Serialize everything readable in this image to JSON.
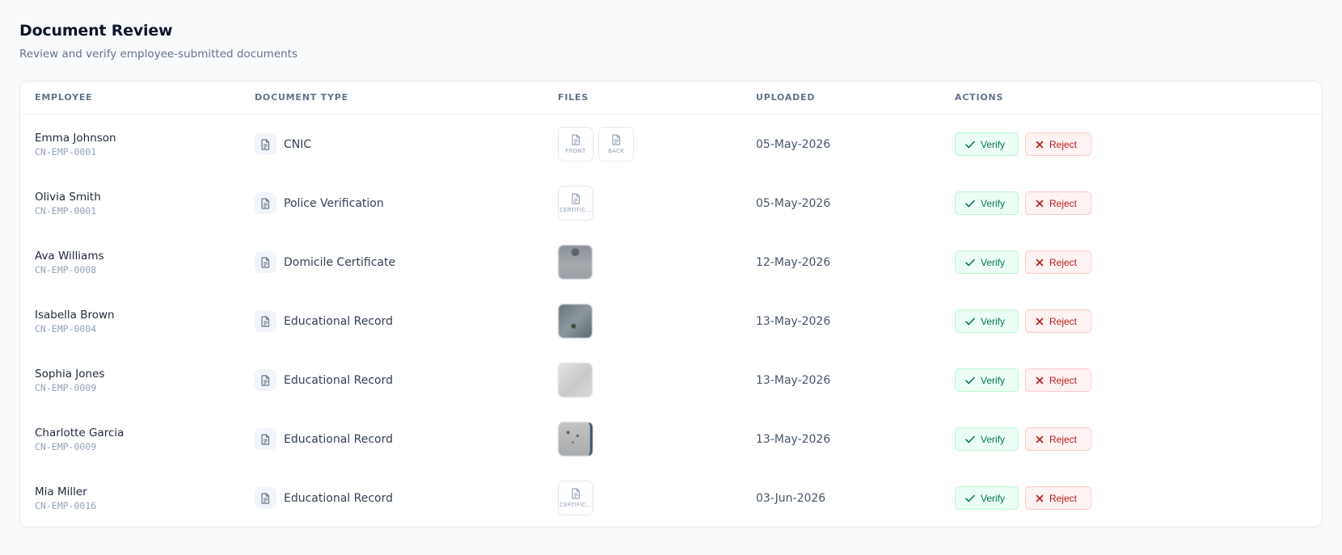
{
  "header": {
    "title": "Document Review",
    "subtitle": "Review and verify employee-submitted documents"
  },
  "table": {
    "columns": [
      "EMPLOYEE",
      "DOCUMENT TYPE",
      "FILES",
      "UPLOADED",
      "ACTIONS"
    ],
    "verify_label": "Verify",
    "reject_label": "Reject",
    "rows": [
      {
        "name": "Emma Johnson",
        "id": "CN-EMP-0001",
        "doc_type": "CNIC",
        "files": [
          {
            "kind": "doc",
            "caption": "FRONT"
          },
          {
            "kind": "doc",
            "caption": "BACK"
          }
        ],
        "uploaded": "05-May-2026"
      },
      {
        "name": "Olivia Smith",
        "id": "CN-EMP-0001",
        "doc_type": "Police Verification",
        "files": [
          {
            "kind": "doc",
            "caption": "CERTIFIC..."
          }
        ],
        "uploaded": "05-May-2026"
      },
      {
        "name": "Ava Williams",
        "id": "CN-EMP-0008",
        "doc_type": "Domicile Certificate",
        "files": [
          {
            "kind": "image",
            "style": "t1"
          }
        ],
        "uploaded": "12-May-2026"
      },
      {
        "name": "Isabella Brown",
        "id": "CN-EMP-0004",
        "doc_type": "Educational Record",
        "files": [
          {
            "kind": "image",
            "style": "t2"
          }
        ],
        "uploaded": "13-May-2026"
      },
      {
        "name": "Sophia Jones",
        "id": "CN-EMP-0009",
        "doc_type": "Educational Record",
        "files": [
          {
            "kind": "image",
            "style": "t3"
          }
        ],
        "uploaded": "13-May-2026"
      },
      {
        "name": "Charlotte Garcia",
        "id": "CN-EMP-0009",
        "doc_type": "Educational Record",
        "files": [
          {
            "kind": "image",
            "style": "t4"
          }
        ],
        "uploaded": "13-May-2026"
      },
      {
        "name": "Mia Miller",
        "id": "CN-EMP-0016",
        "doc_type": "Educational Record",
        "files": [
          {
            "kind": "doc",
            "caption": "CERTIFIC..."
          }
        ],
        "uploaded": "03-Jun-2026"
      }
    ]
  },
  "colors": {
    "verify_text": "#047857",
    "reject_text": "#b91c1c",
    "muted": "#64748b"
  },
  "icons": {
    "document": "document-icon",
    "verify": "check-icon",
    "reject": "x-icon"
  }
}
